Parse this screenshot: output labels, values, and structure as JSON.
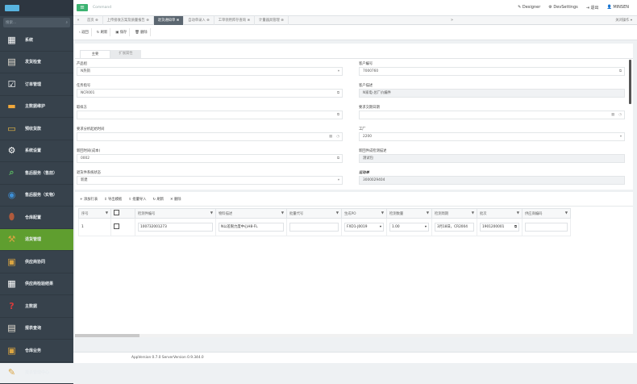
{
  "app": {
    "title": "Command",
    "menu_icon": "hamburger-icon"
  },
  "sidebar": {
    "search_placeholder": "搜索...",
    "items": [
      {
        "label": "系统",
        "icon": "grid-icon",
        "color": "#ffffff"
      },
      {
        "label": "发货检查",
        "icon": "document-icon",
        "color": "#e8e2d6"
      },
      {
        "label": "订单管理",
        "icon": "clipboard-check-icon",
        "color": "#ffffff"
      },
      {
        "label": "主数据维护",
        "icon": "book-icon",
        "color": "#f2a93b"
      },
      {
        "label": "预收货款",
        "icon": "folder-icon",
        "color": "#e7b845"
      },
      {
        "label": "系统设置",
        "icon": "gear-icon",
        "color": "#ffffff"
      },
      {
        "label": "售后服务（售前）",
        "icon": "magnifier-icon",
        "color": "#5bb862"
      },
      {
        "label": "售后服务（实物）",
        "icon": "search-circle-icon",
        "color": "#3d8fd6"
      },
      {
        "label": "仓库配置",
        "icon": "truck-icon",
        "color": "#b05a3c"
      },
      {
        "label": "退货管理",
        "icon": "tools-icon",
        "color": "#d9a441"
      },
      {
        "label": "供应商协同",
        "icon": "box-icon",
        "color": "#d9a441"
      },
      {
        "label": "供应商检验结果",
        "icon": "grid-icon",
        "color": "#ffffff"
      },
      {
        "label": "主数据",
        "icon": "help-icon",
        "color": "#d93b3b"
      },
      {
        "label": "报表查询",
        "icon": "document-icon",
        "color": "#e8e2d6"
      },
      {
        "label": "仓库业务",
        "icon": "box-icon",
        "color": "#d9a441"
      },
      {
        "label": "报表管理中心",
        "icon": "document-pen-icon",
        "color": "#d9a441"
      }
    ]
  },
  "topbar": {
    "designer": "Designer",
    "devsettings": "DevSettings",
    "logout": "退出",
    "user": "MINSEN"
  },
  "tabs": {
    "items": [
      "首页",
      "上传接收方案及质量报告",
      "退货通知单",
      "自动单录入",
      "工单领用库存查询",
      "计量器具管理"
    ],
    "active_index": 2,
    "ops": "关闭操作"
  },
  "toolbar": {
    "back": "返回",
    "refresh": "刷新",
    "save": "保存",
    "delete": "删除"
  },
  "form": {
    "tabs": [
      "主要",
      "扩展属性"
    ],
    "fields": [
      {
        "label": "产品组",
        "value": "N热销",
        "kind": "select"
      },
      {
        "label": "客户编号",
        "value": "7000760",
        "kind": "lookup"
      },
      {
        "label": "任务指号",
        "value": "NCR001",
        "kind": "lookup"
      },
      {
        "label": "客户描述",
        "value": "N家电-总厂价编件",
        "kind": "readonly"
      },
      {
        "label": "取样方",
        "value": "",
        "kind": "lookup"
      },
      {
        "label": "要求交期日期",
        "value": "",
        "kind": "datetime"
      },
      {
        "label": "要求分析起始时间",
        "value": "",
        "kind": "datetime"
      },
      {
        "label": "工厂",
        "value": "2200",
        "kind": "select"
      },
      {
        "label": "新回时间(成本)",
        "value": "0002",
        "kind": "lookup"
      },
      {
        "label": "新回件成检测描述",
        "value": "测试包",
        "kind": "readonly"
      },
      {
        "label": "退货件系统状态",
        "value": "新建",
        "kind": "select"
      },
      {
        "label": "运动单",
        "value": "3000029404",
        "kind": "readonly-bold"
      }
    ]
  },
  "grid": {
    "toolbar": [
      "添加行表",
      "导出模板",
      "批量导入",
      "刷新",
      "删除"
    ],
    "columns": [
      "序号",
      "",
      "检测件编号",
      "物料描述",
      "批量代号",
      "生成PO",
      "检测数量",
      "检测周期",
      "批次",
      "供应商编码"
    ],
    "rows": [
      {
        "seq": "1",
        "part_no": "100732001273",
        "material": "N公差限力度中心H8-FL",
        "lot": "",
        "po": "FXD1-J0019",
        "qty": "1.00",
        "period": "3月18日，CR2004",
        "batch": "1901200001",
        "supplier": ""
      }
    ]
  },
  "footer": {
    "version": "AppVersion 0.7.0 ServerVersion 0.9.344.0"
  }
}
